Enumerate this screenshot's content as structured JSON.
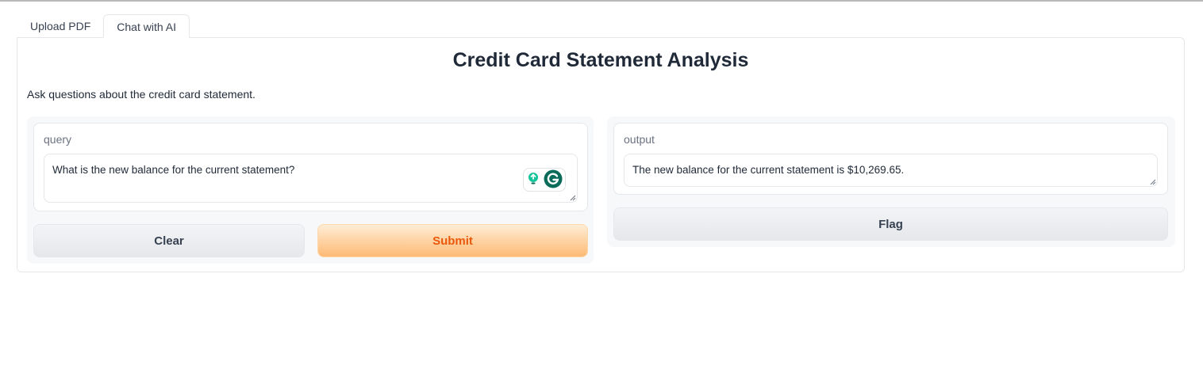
{
  "tabs": [
    {
      "label": "Upload PDF",
      "active": false
    },
    {
      "label": "Chat with AI",
      "active": true
    }
  ],
  "main": {
    "title": "Credit Card Statement Analysis",
    "description": "Ask questions about the credit card statement."
  },
  "query": {
    "label": "query",
    "value": "What is the new balance for the current statement?"
  },
  "output": {
    "label": "output",
    "value": "The new balance for the current statement is $10,269.65."
  },
  "buttons": {
    "clear": "Clear",
    "submit": "Submit",
    "flag": "Flag"
  },
  "icons": {
    "grammarly_bulb": "lightbulb-icon",
    "grammarly_logo": "grammarly-icon"
  },
  "colors": {
    "accent_orange": "#ea580c",
    "grammarly_green": "#15c39a",
    "grammarly_dark": "#0a6b5b"
  }
}
